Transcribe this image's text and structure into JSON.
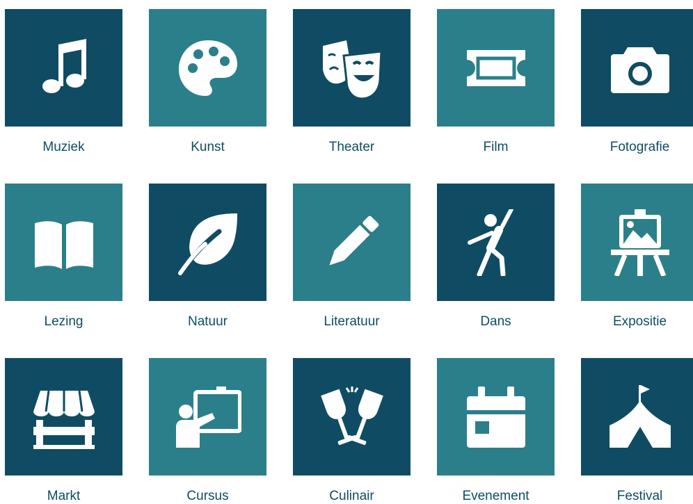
{
  "colors": {
    "dark": "#0f4c63",
    "light": "#2b7f8a",
    "label": "#0f4c63",
    "icon": "#ffffff"
  },
  "categories": [
    {
      "label": "Muziek",
      "icon": "music-note-icon"
    },
    {
      "label": "Kunst",
      "icon": "palette-icon"
    },
    {
      "label": "Theater",
      "icon": "theater-masks-icon"
    },
    {
      "label": "Film",
      "icon": "ticket-icon"
    },
    {
      "label": "Fotografie",
      "icon": "camera-icon"
    },
    {
      "label": "Lezing",
      "icon": "open-book-icon"
    },
    {
      "label": "Natuur",
      "icon": "leaf-icon"
    },
    {
      "label": "Literatuur",
      "icon": "pencil-icon"
    },
    {
      "label": "Dans",
      "icon": "dancer-icon"
    },
    {
      "label": "Expositie",
      "icon": "easel-icon"
    },
    {
      "label": "Markt",
      "icon": "market-stall-icon"
    },
    {
      "label": "Cursus",
      "icon": "teacher-board-icon"
    },
    {
      "label": "Culinair",
      "icon": "wine-glasses-icon"
    },
    {
      "label": "Evenement",
      "icon": "calendar-icon"
    },
    {
      "label": "Festival",
      "icon": "circus-tent-icon"
    }
  ]
}
